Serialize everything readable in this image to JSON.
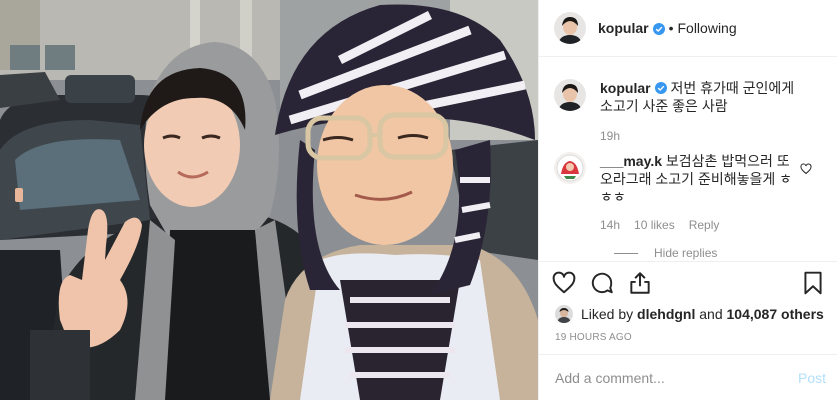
{
  "post": {
    "author": {
      "username": "kopular",
      "verified": true,
      "follow_state": "Following",
      "separator": "•"
    },
    "photo": {
      "subjects": "two men smiling; one in grey hood making peace sign, one in striped bucket hat and tan coat"
    },
    "caption": {
      "username": "kopular",
      "text": "저번 휴가때 군인에게 소고기 사준 좋은 사람",
      "time": "19h"
    },
    "comments": [
      {
        "username": "___may.k",
        "text": "보검삼촌 밥먹으러 또 오라그래 소고기 준비해놓을게 ㅎㅎㅎ",
        "time": "14h",
        "likes": "10 likes",
        "reply_label": "Reply"
      }
    ],
    "hide_replies_label": "Hide replies",
    "likes": {
      "prefix": "Liked by",
      "user": "dlehdgnl",
      "connector": "and",
      "count": "104,087 others"
    },
    "timestamp": "19 HOURS AGO",
    "add_comment": {
      "placeholder": "Add a comment...",
      "post_label": "Post"
    },
    "icons": {
      "like": "heart-icon",
      "comment": "comment-icon",
      "share": "share-icon",
      "save": "bookmark-icon",
      "verified": "verified-badge-icon"
    },
    "colors": {
      "verified_blue": "#3897f0",
      "post_button_disabled": "#b2dffc",
      "muted_text": "#8e8e8e"
    }
  }
}
